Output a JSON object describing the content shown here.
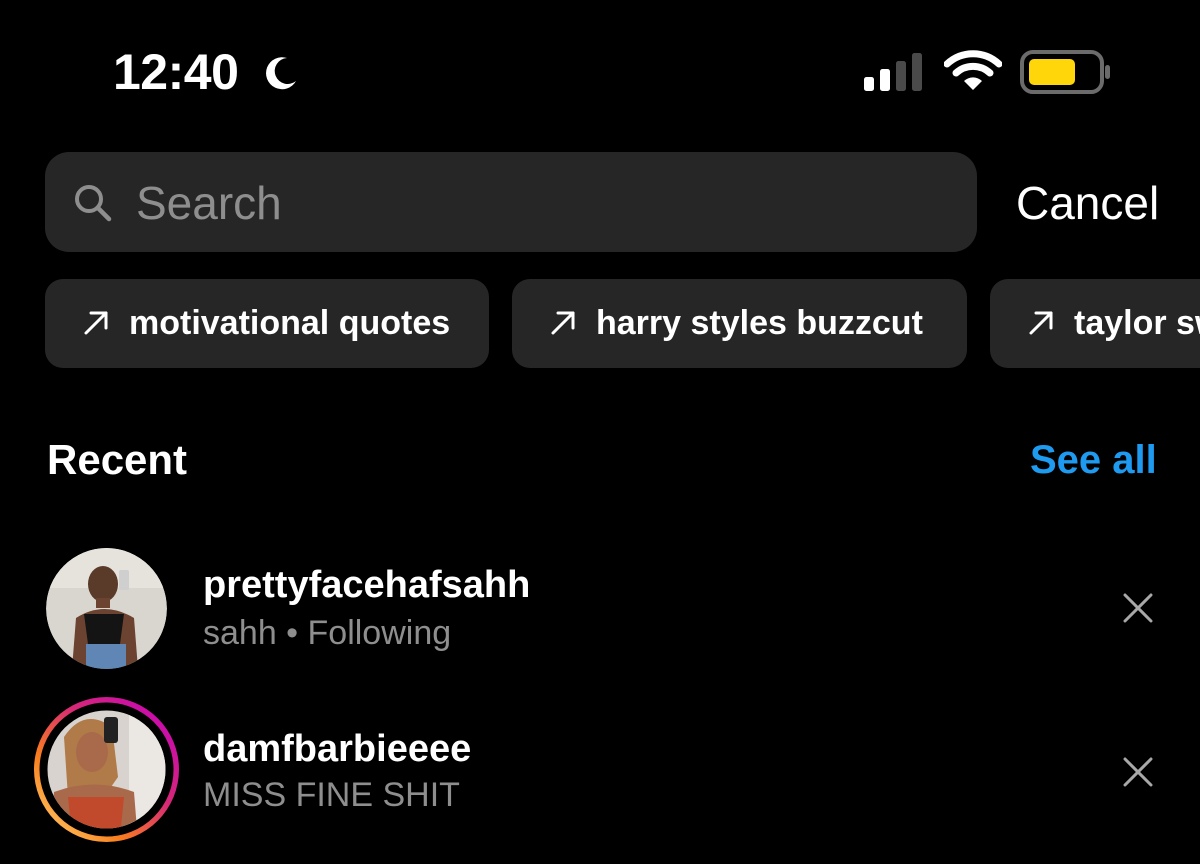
{
  "status_bar": {
    "time": "12:40"
  },
  "search": {
    "placeholder": "Search",
    "cancel_label": "Cancel"
  },
  "suggestions": [
    {
      "label": "motivational quotes"
    },
    {
      "label": "harry styles buzzcut"
    },
    {
      "label": "taylor sw"
    }
  ],
  "recent": {
    "title": "Recent",
    "see_all_label": "See all",
    "items": [
      {
        "username": "prettyfacehafsahh",
        "subtitle": "sahh • Following"
      },
      {
        "username": "damfbarbieeee",
        "subtitle": "MISS FINE SHIT"
      }
    ]
  },
  "colors": {
    "background": "#000000",
    "surface": "#262626",
    "accent": "#1e9bf0",
    "battery": "#ffd60a"
  }
}
